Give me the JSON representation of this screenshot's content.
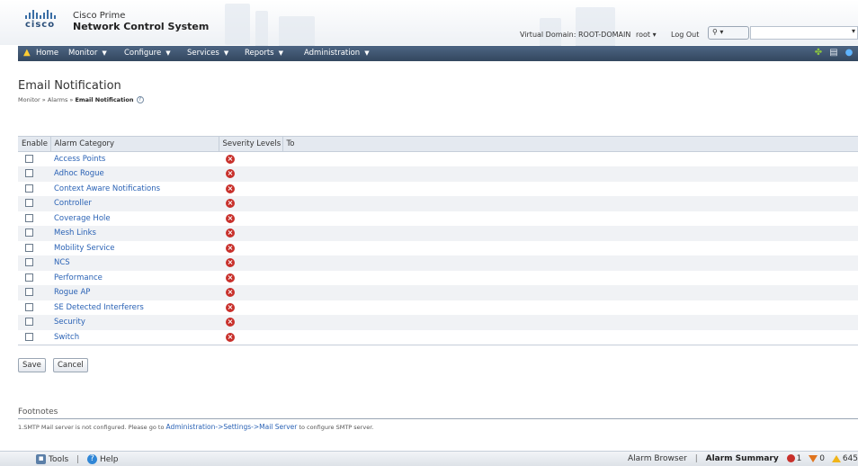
{
  "header": {
    "logo_text": "cisco",
    "product_line1": "Cisco Prime",
    "product_line2": "Network Control System",
    "virtual_domain": "Virtual Domain: ROOT-DOMAIN",
    "user": "root ▾",
    "logout": "Log Out",
    "search_label": "⚲ ▾",
    "search_value": ""
  },
  "menu": {
    "items": [
      {
        "label": "Home"
      },
      {
        "label": "Monitor"
      },
      {
        "label": "Configure"
      },
      {
        "label": "Services"
      },
      {
        "label": "Reports"
      },
      {
        "label": "Administration"
      }
    ],
    "home_icon": "home-icon",
    "right_icons": [
      "plugin-icon",
      "print-icon",
      "help-icon"
    ]
  },
  "page": {
    "title": "Email Notification",
    "breadcrumb": {
      "part1": "Monitor",
      "sep": " » ",
      "part2": "Alarms",
      "current": "Email Notification"
    }
  },
  "table": {
    "headers": [
      "Enable",
      "Alarm Category",
      "Severity Levels",
      "To"
    ],
    "rows": [
      {
        "category": "Access Points"
      },
      {
        "category": "Adhoc Rogue"
      },
      {
        "category": "Context Aware Notifications"
      },
      {
        "category": "Controller"
      },
      {
        "category": "Coverage Hole"
      },
      {
        "category": "Mesh Links"
      },
      {
        "category": "Mobility Service"
      },
      {
        "category": "NCS"
      },
      {
        "category": "Performance"
      },
      {
        "category": "Rogue AP"
      },
      {
        "category": "SE Detected Interferers"
      },
      {
        "category": "Security"
      },
      {
        "category": "Switch"
      }
    ],
    "severity_icon": "critical-x-icon",
    "severity_color": "#c8302b"
  },
  "buttons": {
    "save": "Save",
    "cancel": "Cancel"
  },
  "footnotes": {
    "title": "Footnotes",
    "text_before": "1.SMTP Mail server is not configured. Please go to ",
    "link": "Administration->Settings->Mail Server",
    "text_after": " to configure SMTP server."
  },
  "statusbar": {
    "tools": "Tools",
    "sep": "|",
    "help": "Help",
    "alarm_browser": "Alarm Browser",
    "alarm_summary": "Alarm Summary",
    "critical_count": "1",
    "major_count": "0",
    "minor_count": "645"
  },
  "colors": {
    "menubar": "#3e546f",
    "link": "#2a62b5",
    "critical": "#c8302b"
  }
}
